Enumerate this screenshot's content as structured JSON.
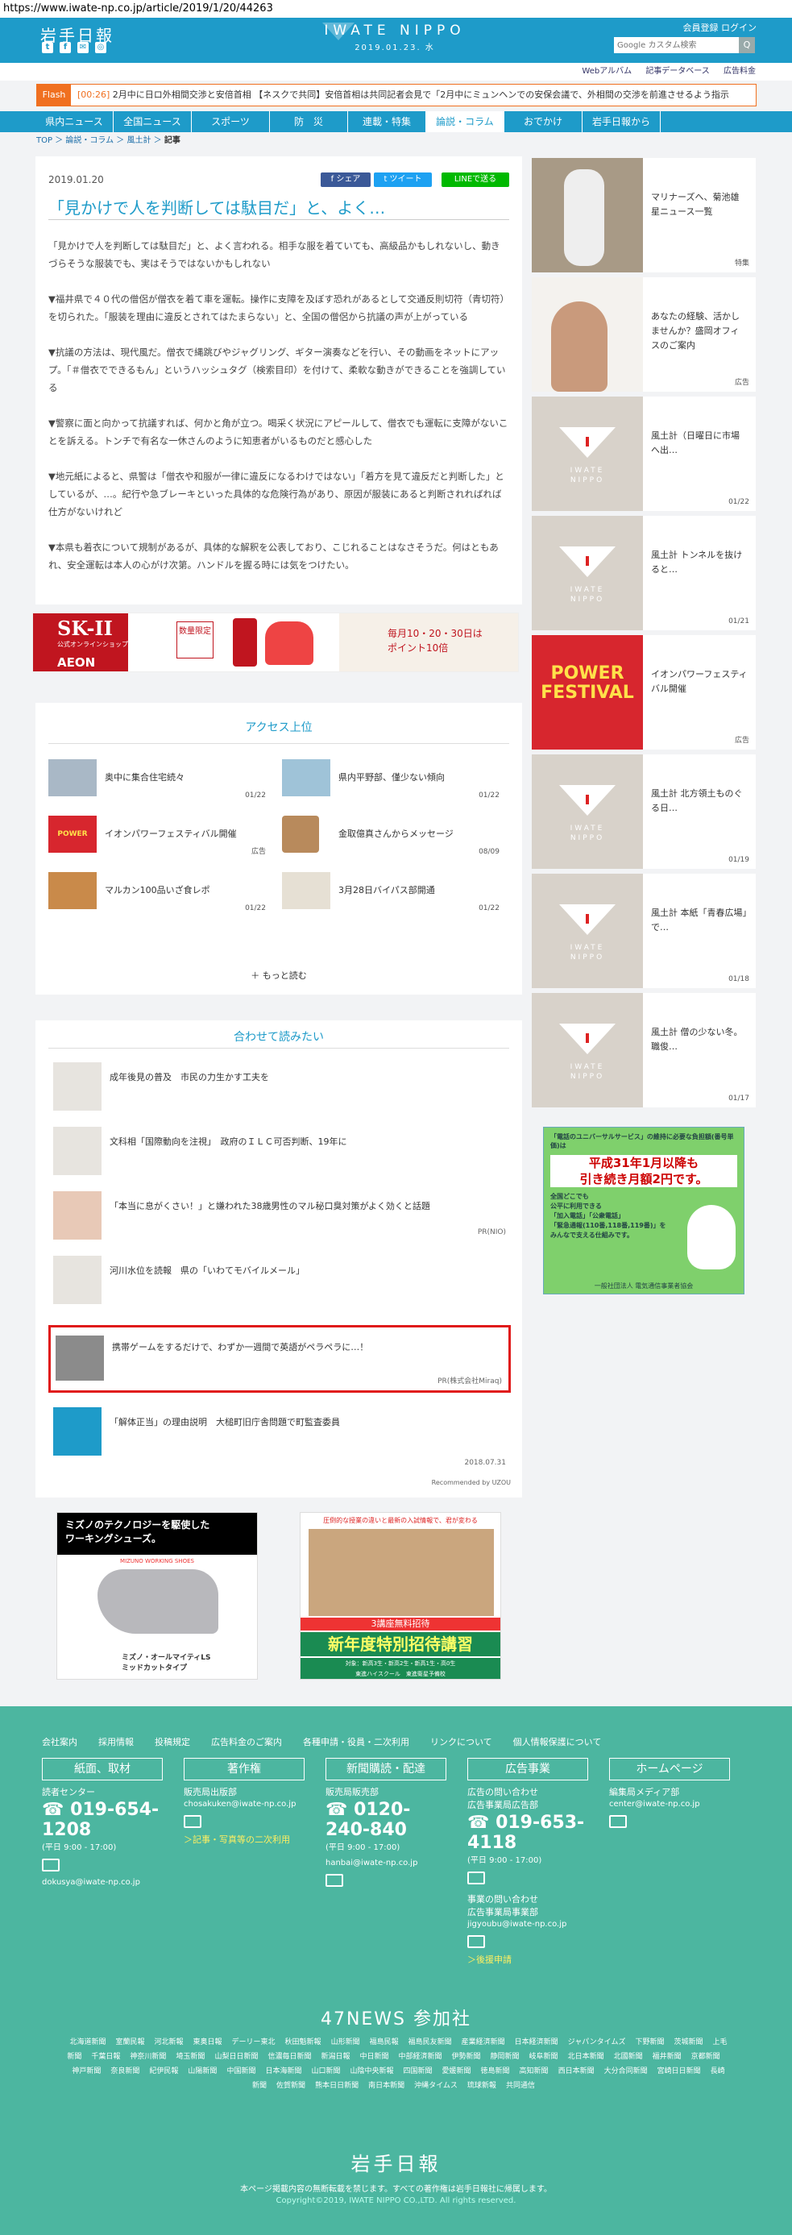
{
  "url": "https://www.iwate-np.co.jp/article/2019/1/20/44263",
  "header": {
    "logo": "岩手日報",
    "center_title": "IWATE NIPPO",
    "center_date": "2019.01.23. 水",
    "member_register": "会員登録",
    "login": "ログイン",
    "search_placeholder": "Google カスタム検索",
    "search_button": "Q"
  },
  "subnav": [
    "Webアルバム",
    "記事データベース",
    "広告料金"
  ],
  "flash": {
    "label": "Flash",
    "time": "[00:26]",
    "text": "2月中に日ロ外相間交渉と安倍首相 【ネスクで共同】安倍首相は共同記者会見で「2月中にミュンヘンでの安保会議で、外相間の交渉を前進させるよう指示"
  },
  "mainnav": [
    {
      "label": "県内ニュース",
      "active": false
    },
    {
      "label": "全国ニュース",
      "active": false
    },
    {
      "label": "スポーツ",
      "active": false
    },
    {
      "label": "防　災",
      "active": false
    },
    {
      "label": "連載・特集",
      "active": false
    },
    {
      "label": "論説・コラム",
      "active": true
    },
    {
      "label": "おでかけ",
      "active": false
    },
    {
      "label": "岩手日報から",
      "active": false
    }
  ],
  "breadcrumb": {
    "top": "TOP",
    "sep": "＞",
    "c1": "論説・コラム",
    "c2": "風土計",
    "current": "記事"
  },
  "article": {
    "date": "2019.01.20",
    "share_fb": "シェア",
    "share_tw": "ツイート",
    "share_line": "LINEで送る",
    "title": "「見かけで人を判断しては駄目だ」と、よく…",
    "paragraphs": [
      "「見かけで人を判断しては駄目だ」と、よく言われる。相手な服を着ていても、高級品かもしれないし、動きづらそうな服装でも、実はそうではないかもしれない",
      "▼福井県で４０代の僧侶が僧衣を着て車を運転。操作に支障を及ぼす恐れがあるとして交通反則切符（青切符）を切られた。「服装を理由に違反とされてはたまらない」と、全国の僧侶から抗議の声が上がっている",
      "▼抗議の方法は、現代風だ。僧衣で縄跳びやジャグリング、ギター演奏などを行い、その動画をネットにアップ。「＃僧衣でできるもん」というハッシュタグ（検索目印）を付けて、柔軟な動きができることを強調している",
      "▼警察に面と向かって抗議すれば、何かと角が立つ。喝采く状況にアピールして、僧衣でも運転に支障がないことを訴える。トンチで有名な一休さんのように知恵者がいるものだと感心した",
      "▼地元紙によると、県警は「僧衣や和服が一律に違反になるわけではない」「着方を見て違反だと判断した」としているが、…。紀行や急ブレーキといった具体的な危険行為があり、原因が服装にあると判断されればれば仕方がないけれど",
      "▼本県も着衣について規制があるが、具体的な解釈を公表しており、こじれることはなさそうだ。何はともあれ、安全運転は本人の心がけ次第。ハンドルを握る時には気をつけたい。"
    ]
  },
  "ad_banner": {
    "brand": "SK-II",
    "brand_sub": "公式オンラインショップ",
    "retailer": "AEON",
    "box": "数量限定",
    "right_text": "毎月10・20・30日は\nポイント10倍"
  },
  "ranking": {
    "title": "アクセス上位",
    "more": "もっと読む",
    "items": [
      {
        "name": "奥中に集合住宅続々",
        "date": "01/22"
      },
      {
        "name": "県内平野部、僅少ない傾向",
        "date": "01/22"
      },
      {
        "name": "イオンパワーフェスティバル開催",
        "date": "広告"
      },
      {
        "name": "金取億真さんからメッセージ",
        "date": "08/09"
      },
      {
        "name": "マルカン100品いざ食レポ",
        "date": "01/22"
      },
      {
        "name": "3月28日バイパス部開通",
        "date": "01/22"
      }
    ]
  },
  "related": {
    "title": "合わせて読みたい",
    "items": [
      {
        "name": "成年後見の普及　市民の力生かす工夫を",
        "pr": ""
      },
      {
        "name": "文科相「国際動向を注視」　政府のＩＬＣ可否判断、19年に",
        "pr": ""
      },
      {
        "name": "「本当に息がくさい！」と嫌われた38歳男性のマル秘口臭対策がよく効くと話題",
        "pr": "PR(NIO)"
      },
      {
        "name": "河川水位を読報　県の「いわてモバイルメール」",
        "pr": ""
      },
      {
        "name": "携帯ゲームをするだけで、わずか一週間で英語がペラペラに…！",
        "pr": "PR(株式会社Miraq)"
      },
      {
        "name": "「解体正当」の理由説明　大槌町旧庁舎問題で町監査委員",
        "pr": "2018.07.31"
      }
    ],
    "recommended": "Recommended by UZOU"
  },
  "bottom_ads": {
    "left_title": "ミズノのテクノロジーを駆使した\nワーキングシューズ。",
    "left_sub": "MIZUNO WORKING SHOES",
    "left_product": "ミズノ・オールマイティLS\nミッドカットタイプ",
    "right_top": "圧倒的な授業の違いと最新の入試情報で、君が変わる",
    "right_banner": "3講座無料招待",
    "right_title": "新年度特別招待講習",
    "right_sub": "対象：新高3生・新高2生・新高1生・高0生",
    "right_brand": "東進ハイスクール　東進衛星予備校"
  },
  "sidebar": [
    {
      "name": "マリナーズへ、菊池雄星ニュース一覧",
      "date": "特集"
    },
    {
      "name": "あなたの経験、活かしませんか？盛岡オフィスのご案内",
      "date": "広告"
    },
    {
      "name": "風土計（日曜日に市場へ出…",
      "date": "01/22"
    },
    {
      "name": "風土計 トンネルを抜けると…",
      "date": "01/21"
    },
    {
      "name": "イオンパワーフェスティバル開催",
      "date": "広告"
    },
    {
      "name": "風土計 北方領土ものぐる日…",
      "date": "01/19"
    },
    {
      "name": "風土計 本紙「青春広場」で…",
      "date": "01/18"
    },
    {
      "name": "風土計 僧の少ない冬。職俊…",
      "date": "01/17"
    }
  ],
  "sidebar_ad": {
    "top": "「電話のユニバーサルサービス」の維持に必要な負担額(番号単価)は",
    "main": "平成31年1月以降も\n引き続き月額2円です。",
    "mid": "全国どこでも\n公平に利用できる\n「加入電話」「公衆電話」\n「緊急通報(110番,118番,119番)」を\nみんなで支える仕組みです。",
    "org": "一般社団法人 電気通信事業者協会"
  },
  "footer": {
    "links": [
      "会社案内",
      "採用情報",
      "投稿規定",
      "広告料金のご案内",
      "各種申請・役員・二次利用",
      "リンクについて",
      "個人情報保護について"
    ],
    "cols": [
      {
        "head": "紙面、取材",
        "sub": "読者センター",
        "phone": "019-654-1208",
        "hours": "(平日 9:00 - 17:00)",
        "mail": "dokusya@iwate-np.co.jp",
        "link": ""
      },
      {
        "head": "著作権",
        "sub": "販売局出版部",
        "phone": "",
        "hours": "",
        "mail": "chosakuken@iwate-np.co.jp",
        "link": "＞記事・写真等の二次利用"
      },
      {
        "head": "新聞購読・配達",
        "sub": "販売局販売部",
        "phone": "0120-240-840",
        "hours": "(平日 9:00 - 17:00)",
        "mail": "hanbai@iwate-np.co.jp",
        "link": ""
      },
      {
        "head": "広告事業",
        "sub": "広告の問い合わせ\n広告事業局広告部",
        "phone": "019-653-4118",
        "hours": "(平日 9:00 - 17:00)",
        "mail": "jigyoubu@iwate-np.co.jp",
        "link": "＞後援申請",
        "sub2": "事業の問い合わせ\n広告事業局事業部"
      },
      {
        "head": "ホームページ",
        "sub": "編集局メディア部",
        "phone": "",
        "hours": "",
        "mail": "center@iwate-np.co.jp",
        "link": ""
      }
    ],
    "news47": "47NEWS 参加社",
    "papers": [
      "北海道新聞",
      "室蘭民報",
      "河北新報",
      "東奥日報",
      "デーリー東北",
      "秋田魁新報",
      "山形新聞",
      "福島民報",
      "福島民友新聞",
      "産業経済新聞",
      "日本経済新聞",
      "ジャパンタイムズ",
      "下野新聞",
      "茨城新聞",
      "上毛新聞",
      "千葉日報",
      "神奈川新聞",
      "埼玉新聞",
      "山梨日日新聞",
      "信濃毎日新聞",
      "新潟日報",
      "中日新聞",
      "中部経済新聞",
      "伊勢新聞",
      "静岡新聞",
      "岐阜新聞",
      "北日本新聞",
      "北國新聞",
      "福井新聞",
      "京都新聞",
      "神戸新聞",
      "奈良新聞",
      "紀伊民報",
      "山陽新聞",
      "中国新聞",
      "日本海新聞",
      "山口新聞",
      "山陰中央新報",
      "四国新聞",
      "愛媛新聞",
      "徳島新聞",
      "高知新聞",
      "西日本新聞",
      "大分合同新聞",
      "宮崎日日新聞",
      "長崎新聞",
      "佐賀新聞",
      "熊本日日新聞",
      "南日本新聞",
      "沖縄タイムス",
      "琉球新報",
      "共同通信"
    ],
    "logo": "岩手日報",
    "notice": "本ページ掲載内容の無断転載を禁じます。すべての著作権は岩手日報社に帰属します。",
    "copyright": "Copyright©2019, IWATE NIPPO CO.,LTD. All rights reserved."
  }
}
